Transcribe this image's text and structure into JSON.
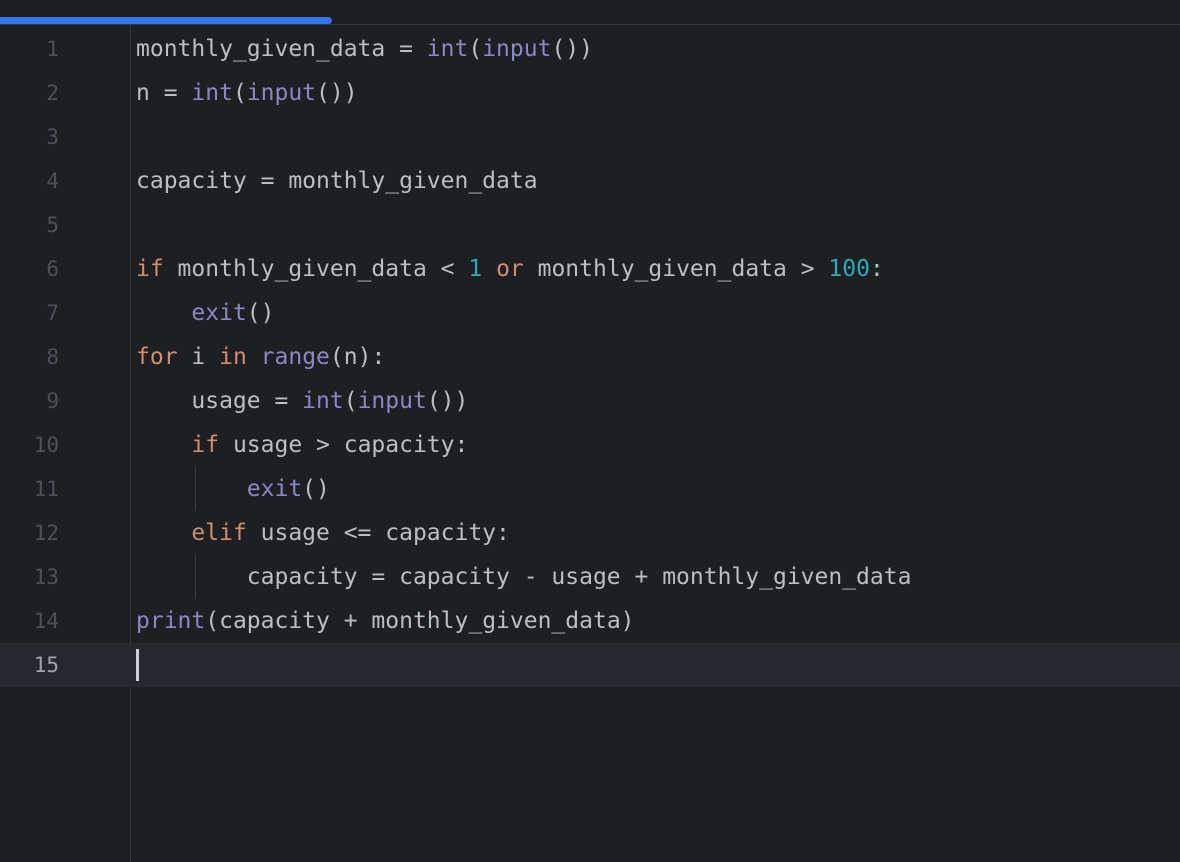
{
  "editor": {
    "language": "python",
    "current_line": 15,
    "lines": [
      {
        "number": "1",
        "tokens": [
          {
            "t": "monthly_given_data = ",
            "k": "txt"
          },
          {
            "t": "int",
            "k": "bi"
          },
          {
            "t": "(",
            "k": "txt"
          },
          {
            "t": "input",
            "k": "bi"
          },
          {
            "t": "())",
            "k": "txt"
          }
        ]
      },
      {
        "number": "2",
        "tokens": [
          {
            "t": "n = ",
            "k": "txt"
          },
          {
            "t": "int",
            "k": "bi"
          },
          {
            "t": "(",
            "k": "txt"
          },
          {
            "t": "input",
            "k": "bi"
          },
          {
            "t": "())",
            "k": "txt"
          }
        ]
      },
      {
        "number": "3",
        "tokens": []
      },
      {
        "number": "4",
        "tokens": [
          {
            "t": "capacity = monthly_given_data",
            "k": "txt"
          }
        ]
      },
      {
        "number": "5",
        "tokens": []
      },
      {
        "number": "6",
        "tokens": [
          {
            "t": "if",
            "k": "kw"
          },
          {
            "t": " monthly_given_data < ",
            "k": "txt"
          },
          {
            "t": "1",
            "k": "num"
          },
          {
            "t": " ",
            "k": "txt"
          },
          {
            "t": "or",
            "k": "kw"
          },
          {
            "t": " monthly_given_data > ",
            "k": "txt"
          },
          {
            "t": "100",
            "k": "num"
          },
          {
            "t": ":",
            "k": "txt"
          }
        ]
      },
      {
        "number": "7",
        "tokens": [
          {
            "t": "    ",
            "k": "txt"
          },
          {
            "t": "exit",
            "k": "bi"
          },
          {
            "t": "()",
            "k": "txt"
          }
        ]
      },
      {
        "number": "8",
        "tokens": [
          {
            "t": "for",
            "k": "kw"
          },
          {
            "t": " i ",
            "k": "txt"
          },
          {
            "t": "in",
            "k": "kw"
          },
          {
            "t": " ",
            "k": "txt"
          },
          {
            "t": "range",
            "k": "bi"
          },
          {
            "t": "(n):",
            "k": "txt"
          }
        ]
      },
      {
        "number": "9",
        "tokens": [
          {
            "t": "    usage = ",
            "k": "txt"
          },
          {
            "t": "int",
            "k": "bi"
          },
          {
            "t": "(",
            "k": "txt"
          },
          {
            "t": "input",
            "k": "bi"
          },
          {
            "t": "())",
            "k": "txt"
          }
        ]
      },
      {
        "number": "10",
        "tokens": [
          {
            "t": "    ",
            "k": "txt"
          },
          {
            "t": "if",
            "k": "kw"
          },
          {
            "t": " usage > capacity:",
            "k": "txt"
          }
        ]
      },
      {
        "number": "11",
        "guide": true,
        "tokens": [
          {
            "t": "        ",
            "k": "txt"
          },
          {
            "t": "exit",
            "k": "bi"
          },
          {
            "t": "()",
            "k": "txt"
          }
        ]
      },
      {
        "number": "12",
        "tokens": [
          {
            "t": "    ",
            "k": "txt"
          },
          {
            "t": "elif",
            "k": "kw"
          },
          {
            "t": " usage <= capacity:",
            "k": "txt"
          }
        ]
      },
      {
        "number": "13",
        "guide": true,
        "tokens": [
          {
            "t": "        capacity = capacity - usage + monthly_given_data",
            "k": "txt"
          }
        ]
      },
      {
        "number": "14",
        "tokens": [
          {
            "t": "print",
            "k": "bi"
          },
          {
            "t": "(capacity + monthly_given_data)",
            "k": "txt"
          }
        ]
      },
      {
        "number": "15",
        "tokens": []
      }
    ]
  },
  "colors": {
    "background": "#1e1f22",
    "keyword": "#cf8e6d",
    "builtin": "#8888c6",
    "number": "#2aacb8",
    "text": "#bcbec4",
    "line_number": "#4b5059",
    "progress_accent": "#3574f0"
  }
}
